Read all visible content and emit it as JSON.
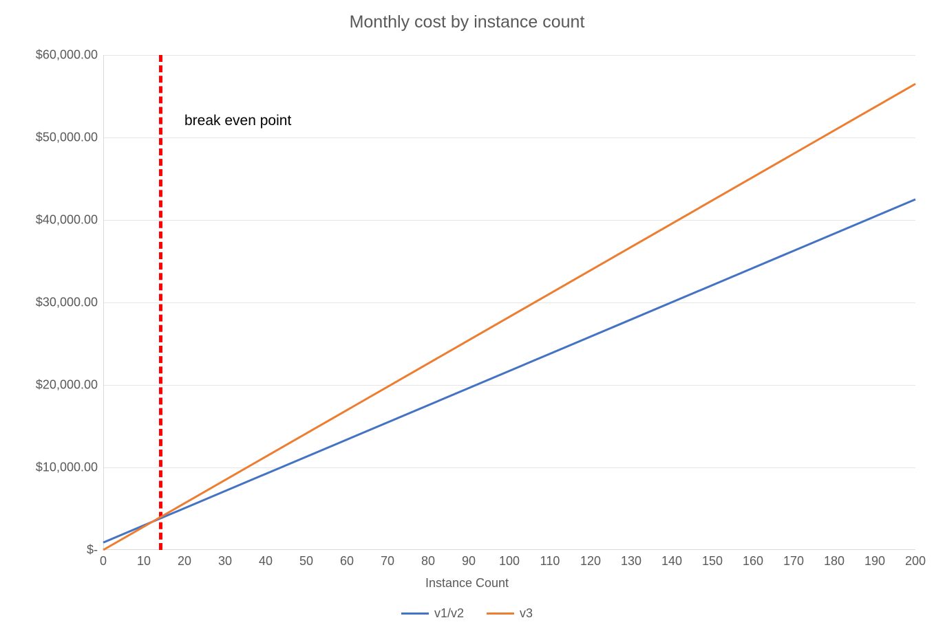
{
  "chart_data": {
    "type": "line",
    "title": "Monthly cost by instance count",
    "xlabel": "Instance Count",
    "ylabel": "",
    "xlim": [
      0,
      200
    ],
    "ylim": [
      0,
      60000
    ],
    "x_ticks": [
      0,
      10,
      20,
      30,
      40,
      50,
      60,
      70,
      80,
      90,
      100,
      110,
      120,
      130,
      140,
      150,
      160,
      170,
      180,
      190,
      200
    ],
    "y_ticks": [
      0,
      10000,
      20000,
      30000,
      40000,
      50000,
      60000
    ],
    "y_tick_labels": [
      "$-",
      "$10,000.00",
      "$20,000.00",
      "$30,000.00",
      "$40,000.00",
      "$50,000.00",
      "$60,000.00"
    ],
    "series": [
      {
        "name": "v1/v2",
        "color": "#4472c4",
        "points": [
          [
            0,
            900
          ],
          [
            200,
            42500
          ]
        ]
      },
      {
        "name": "v3",
        "color": "#ed7d31",
        "points": [
          [
            0,
            0
          ],
          [
            200,
            56500
          ]
        ]
      }
    ],
    "annotations": [
      {
        "type": "vline",
        "x": 14,
        "color": "#ff0000",
        "dash": true
      },
      {
        "type": "text",
        "text": "break even point",
        "x": 20,
        "y": 53000
      }
    ],
    "legend_position": "bottom",
    "grid": {
      "y": true,
      "x": false
    }
  }
}
